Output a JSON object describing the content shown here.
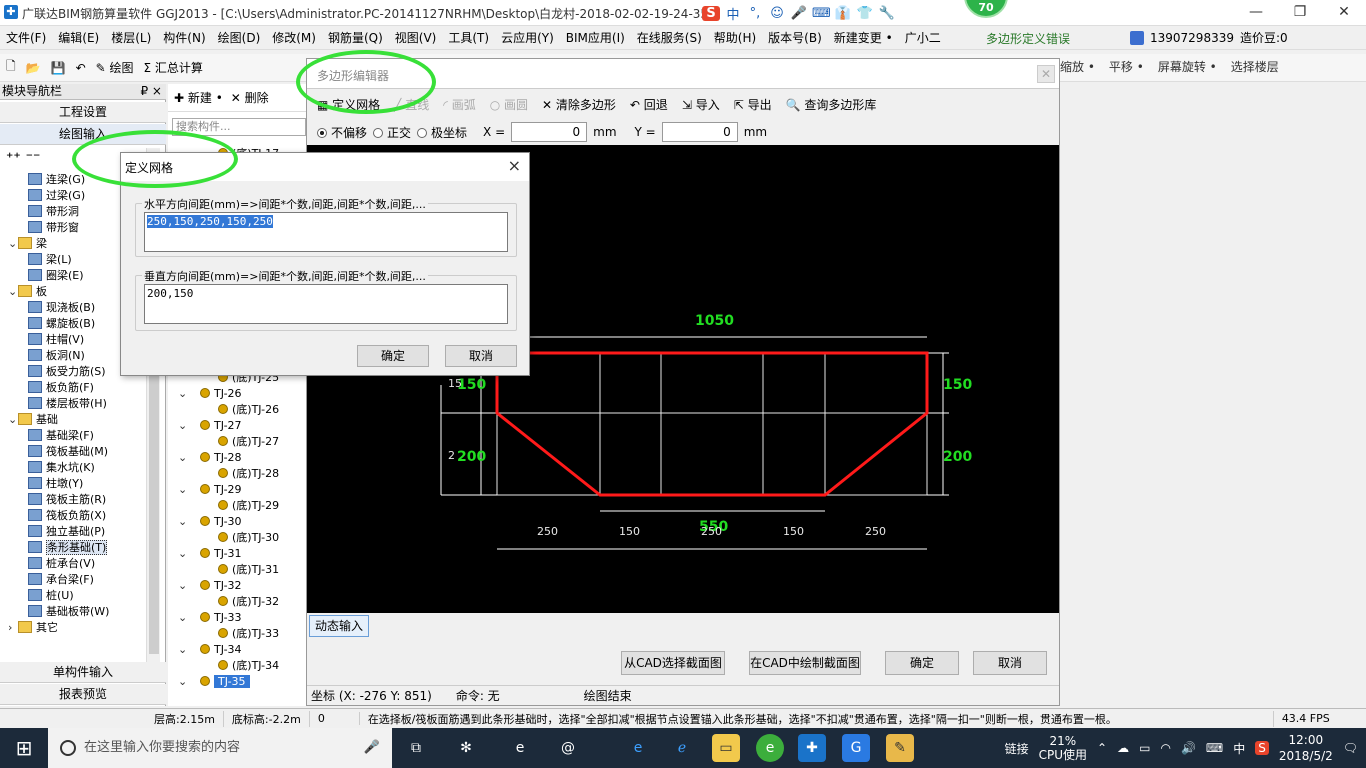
{
  "titlebar": {
    "title": "广联达BIM钢筋算量软件 GGJ2013 - [C:\\Users\\Administrator.PC-20141127NRHM\\Desktop\\白龙村-2018-02-02-19-24-35",
    "ime": [
      "S",
      "中",
      "°,",
      "☺",
      "🎤",
      "⌨",
      "👔",
      "👕",
      "🔧"
    ],
    "badge": "70"
  },
  "menu": [
    "文件(F)",
    "编辑(E)",
    "楼层(L)",
    "构件(N)",
    "绘图(D)",
    "修改(M)",
    "钢筋量(Q)",
    "视图(V)",
    "工具(T)",
    "云应用(Y)",
    "BIM应用(I)",
    "在线服务(S)",
    "帮助(H)",
    "版本号(B)",
    "新建变更 •",
    "广小二"
  ],
  "error_text": "多边形定义错误",
  "account": {
    "phone": "13907298339",
    "beans": "造价豆:0"
  },
  "toolbar": {
    "draw": "绘图",
    "sum": "汇总计算",
    "right": [
      "缩放 •",
      "平移 •",
      "屏幕旋转 •",
      "选择楼层"
    ]
  },
  "nav": {
    "title": "模块导航栏",
    "pin": "₽ ×",
    "buttons": [
      "工程设置",
      "绘图输入"
    ],
    "bottom_buttons": [
      "单构件输入",
      "报表预览"
    ],
    "tree": [
      {
        "label": "连梁(G)",
        "level": 2
      },
      {
        "label": "过梁(G)",
        "level": 2
      },
      {
        "label": "带形洞",
        "level": 2
      },
      {
        "label": "带形窗",
        "level": 2
      },
      {
        "label": "梁",
        "level": 1,
        "folder": true
      },
      {
        "label": "梁(L)",
        "level": 2
      },
      {
        "label": "圈梁(E)",
        "level": 2
      },
      {
        "label": "板",
        "level": 1,
        "folder": true
      },
      {
        "label": "现浇板(B)",
        "level": 2
      },
      {
        "label": "螺旋板(B)",
        "level": 2
      },
      {
        "label": "柱帽(V)",
        "level": 2
      },
      {
        "label": "板洞(N)",
        "level": 2
      },
      {
        "label": "板受力筋(S)",
        "level": 2
      },
      {
        "label": "板负筋(F)",
        "level": 2
      },
      {
        "label": "楼层板带(H)",
        "level": 2
      },
      {
        "label": "基础",
        "level": 1,
        "folder": true
      },
      {
        "label": "基础梁(F)",
        "level": 2
      },
      {
        "label": "筏板基础(M)",
        "level": 2
      },
      {
        "label": "集水坑(K)",
        "level": 2
      },
      {
        "label": "柱墩(Y)",
        "level": 2
      },
      {
        "label": "筏板主筋(R)",
        "level": 2
      },
      {
        "label": "筏板负筋(X)",
        "level": 2
      },
      {
        "label": "独立基础(P)",
        "level": 2
      },
      {
        "label": "条形基础(T)",
        "level": 2,
        "selected": true
      },
      {
        "label": "桩承台(V)",
        "level": 2
      },
      {
        "label": "承台梁(F)",
        "level": 2
      },
      {
        "label": "桩(U)",
        "level": 2
      },
      {
        "label": "基础板带(W)",
        "level": 2
      },
      {
        "label": "其它",
        "level": 1,
        "folder": true,
        "collapsed": true
      }
    ]
  },
  "panel2": {
    "new": "新建 •",
    "delete": "删除",
    "search_placeholder": "搜索构件...",
    "rows": [
      {
        "label": "(底)TJ-17",
        "sub": true
      },
      {
        "label": "(底)TJ-25",
        "sub": true
      },
      {
        "label": "TJ-26",
        "sub": false
      },
      {
        "label": "(底)TJ-26",
        "sub": true
      },
      {
        "label": "TJ-27",
        "sub": false
      },
      {
        "label": "(底)TJ-27",
        "sub": true
      },
      {
        "label": "TJ-28",
        "sub": false
      },
      {
        "label": "(底)TJ-28",
        "sub": true
      },
      {
        "label": "TJ-29",
        "sub": false
      },
      {
        "label": "(底)TJ-29",
        "sub": true
      },
      {
        "label": "TJ-30",
        "sub": false
      },
      {
        "label": "(底)TJ-30",
        "sub": true
      },
      {
        "label": "TJ-31",
        "sub": false
      },
      {
        "label": "(底)TJ-31",
        "sub": true
      },
      {
        "label": "TJ-32",
        "sub": false
      },
      {
        "label": "(底)TJ-32",
        "sub": true
      },
      {
        "label": "TJ-33",
        "sub": false
      },
      {
        "label": "(底)TJ-33",
        "sub": true
      },
      {
        "label": "TJ-34",
        "sub": false
      },
      {
        "label": "(底)TJ-34",
        "sub": true
      },
      {
        "label": "TJ-35",
        "sub": false,
        "selected": true
      }
    ]
  },
  "poly": {
    "title": "多边形编辑器",
    "tools": {
      "grid": "定义网格",
      "line": "直线",
      "arc": "画弧",
      "circle": "画圆",
      "clear": "清除多边形",
      "undo": "回退",
      "import": "导入",
      "export": "导出",
      "lib": "查询多边形库"
    },
    "coords": {
      "opt1": "不偏移",
      "opt2": "正交",
      "opt3": "极坐标",
      "x_label": "X =",
      "x": "0",
      "y_label": "Y =",
      "y": "0",
      "unit": "mm"
    },
    "dims": {
      "top": "1050",
      "bottom": "550",
      "left1": "150",
      "left2": "200",
      "right1": "150",
      "right2": "200",
      "left1_small": "15",
      "left2_small": "2",
      "seg": [
        "250",
        "150",
        "250",
        "150",
        "250"
      ]
    },
    "dyn": "动态输入",
    "buttons": {
      "from_cad": "从CAD选择截面图",
      "draw_cad": "在CAD中绘制截面图",
      "ok": "确定",
      "cancel": "取消"
    },
    "status": {
      "coord": "坐标 (X: -276 Y: 851)",
      "cmd": "命令: 无",
      "state": "绘图结束"
    }
  },
  "grid": {
    "title": "定义网格",
    "close": "×",
    "h_label": "水平方向间距(mm)=>间距*个数,间距,间距*个数,间距,...",
    "h_value": "250,150,250,150,250",
    "v_label": "垂直方向间距(mm)=>间距*个数,间距,间距*个数,间距,...",
    "v_value": "200,150",
    "ok": "确定",
    "cancel": "取消"
  },
  "status": {
    "floor_h": "层高:2.15m",
    "base_h": "底标高:-2.2m",
    "zero": "0",
    "msg": "在选择板/筏板面筋遇到此条形基础时，选择\"全部扣减\"根据节点设置锚入此条形基础，选择\"不扣减\"贯通布置，选择\"隔一扣一\"则断一根，贯通布置一根。",
    "fps": "43.4 FPS"
  },
  "taskbar": {
    "search": "在这里输入你要搜索的内容",
    "link": "链接",
    "cpu_pct": "21%",
    "cpu_label": "CPU使用",
    "ime": "中",
    "time": "12:00",
    "date": "2018/5/2"
  },
  "colors": {
    "accent": "#3378d6",
    "shape": "#ff1a1a",
    "dim": "#22dd22",
    "ellipse": "#38e038"
  }
}
